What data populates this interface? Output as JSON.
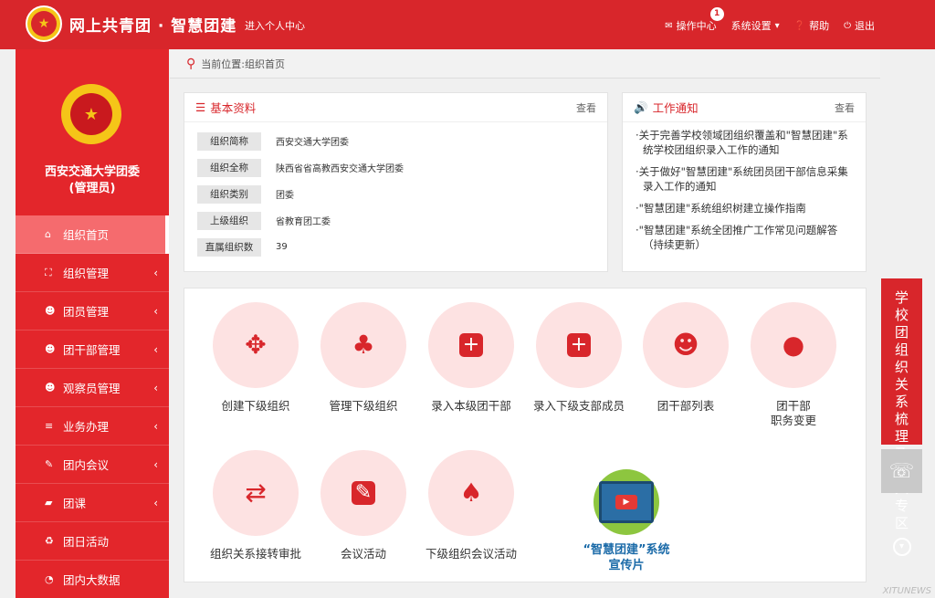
{
  "header": {
    "brand": "网上共青团 · 智慧团建",
    "enter_personal": "进入个人中心",
    "ops_center": "操作中心",
    "ops_badge": "1",
    "settings": "系统设置",
    "help": "帮助",
    "logout": "退出"
  },
  "sidebar": {
    "org_name": "西安交通大学团委",
    "org_role": "(管理员)",
    "items": [
      {
        "label": "组织首页",
        "icon": "home-icon"
      },
      {
        "label": "组织管理",
        "icon": "sitemap-icon"
      },
      {
        "label": "团员管理",
        "icon": "users-icon"
      },
      {
        "label": "团干部管理",
        "icon": "users-icon"
      },
      {
        "label": "观察员管理",
        "icon": "users-icon"
      },
      {
        "label": "业务办理",
        "icon": "list-icon"
      },
      {
        "label": "团内会议",
        "icon": "edit-icon"
      },
      {
        "label": "团课",
        "icon": "folder-icon"
      },
      {
        "label": "团日活动",
        "icon": "recycle-icon"
      },
      {
        "label": "团内大数据",
        "icon": "pie-chart-icon"
      }
    ]
  },
  "breadcrumb": {
    "text": "当前位置:组织首页"
  },
  "basic_info": {
    "title": "基本资料",
    "view": "查看",
    "rows": [
      {
        "label": "组织简称",
        "value": "西安交通大学团委"
      },
      {
        "label": "组织全称",
        "value": "陕西省省高教西安交通大学团委"
      },
      {
        "label": "组织类别",
        "value": "团委"
      },
      {
        "label": "上级组织",
        "value": "省教育团工委"
      },
      {
        "label": "直属组织数",
        "value": "39"
      }
    ]
  },
  "notices": {
    "title": "工作通知",
    "view": "查看",
    "items": [
      "·关于完善学校领域团组织覆盖和\"智慧团建\"系统学校团组织录入工作的通知",
      "·关于做好\"智慧团建\"系统团员团干部信息采集录入工作的通知",
      "·\"智慧团建\"系统组织树建立操作指南",
      "·\"智慧团建\"系统全团推广工作常见问题解答（持续更新）"
    ]
  },
  "features": [
    {
      "label": "创建下级组织",
      "icon": "move-arrows-icon"
    },
    {
      "label": "管理下级组织",
      "icon": "org-chart-icon"
    },
    {
      "label": "录入本级团干部",
      "icon": "plus-square-icon"
    },
    {
      "label": "录入下级支部成员",
      "icon": "plus-square-icon"
    },
    {
      "label": "团干部列表",
      "icon": "group-icon"
    },
    {
      "label": "团干部",
      "label2": "职务变更",
      "icon": "user-icon"
    },
    {
      "label": "组织关系接转审批",
      "icon": "transfer-icon"
    },
    {
      "label": "会议活动",
      "icon": "pencil-square-icon"
    },
    {
      "label": "下级组织会议活动",
      "icon": "tree-icon"
    }
  ],
  "video": {
    "line1": "“智慧团建”系统",
    "line2": "宣传片"
  },
  "float_cta": {
    "text": "学校团组织关系梳理及录入专区"
  },
  "watermark": "XITUNEWS"
}
